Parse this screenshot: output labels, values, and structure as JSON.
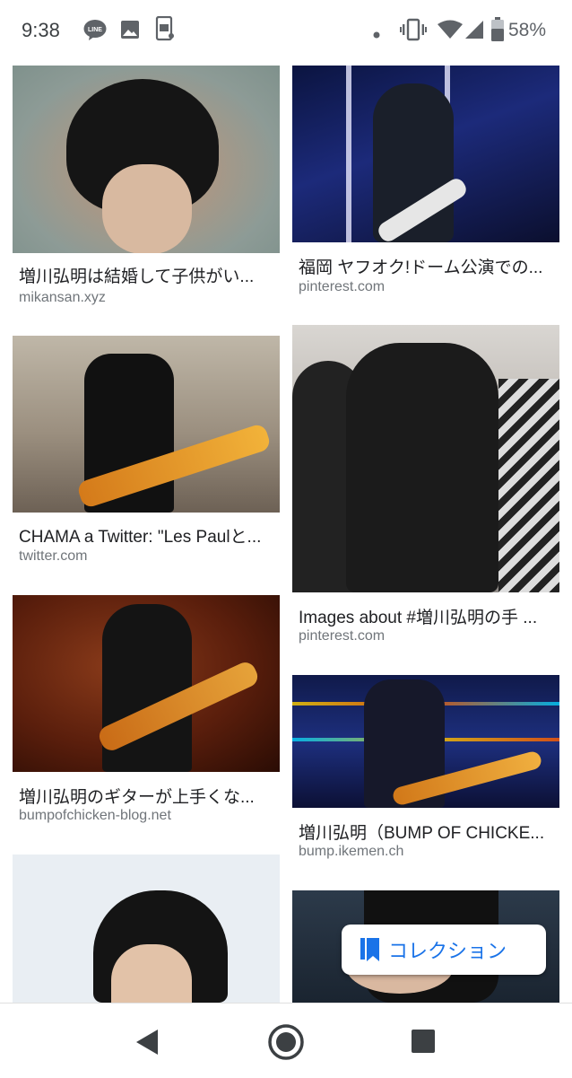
{
  "status_bar": {
    "time": "9:38",
    "battery": "58%",
    "icons": [
      "line-app-icon",
      "gallery-icon",
      "screenshot-icon",
      "dot-icon",
      "vibrate-icon",
      "wifi-icon",
      "signal-icon",
      "battery-icon"
    ]
  },
  "results": [
    {
      "title": "増川弘明は結婚して子供がい...",
      "source": "mikansan.xyz"
    },
    {
      "title": "福岡 ヤフオク!ドーム公演での...",
      "source": "pinterest.com"
    },
    {
      "title": "CHAMA a Twitter: \"Les Paulと...",
      "source": "twitter.com"
    },
    {
      "title": "Images about #増川弘明の手 ...",
      "source": "pinterest.com"
    },
    {
      "title": "増川弘明のギターが上手くな...",
      "source": "bumpofchicken-blog.net"
    },
    {
      "title": "増川弘明（BUMP OF CHICKE...",
      "source": "bump.ikemen.ch"
    },
    {
      "title": "",
      "source": ""
    },
    {
      "title": "",
      "source": ""
    }
  ],
  "collection_chip": {
    "label": "コレクション",
    "icon": "bookmark-icon"
  },
  "nav_bar": {
    "icons": [
      "back-icon",
      "home-icon",
      "recents-icon"
    ]
  },
  "colors": {
    "accent": "#1a73e8",
    "source_text": "#70757a",
    "title_text": "#202124"
  }
}
